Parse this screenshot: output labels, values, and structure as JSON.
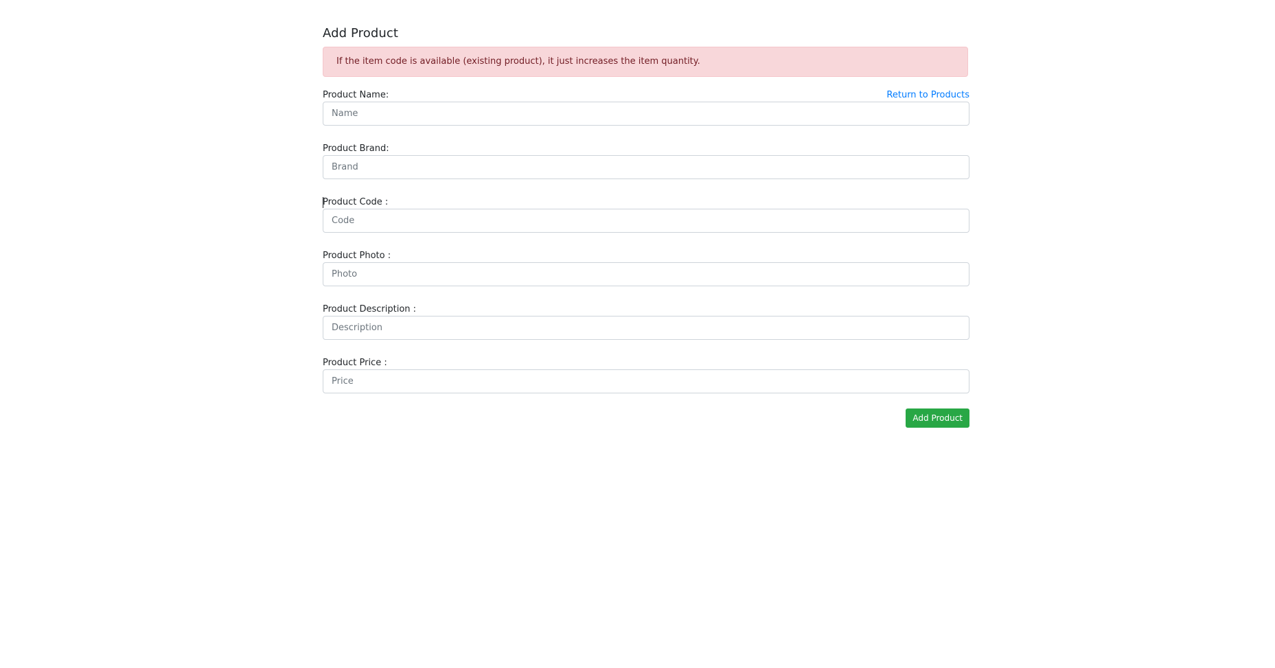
{
  "page": {
    "title": "Add Product"
  },
  "alert": {
    "message": "If the item code is available (existing product), it just increases the item quantity."
  },
  "form": {
    "return_link": "Return to Products",
    "fields": [
      {
        "label": "Product Name:",
        "placeholder": "Name"
      },
      {
        "label": "Product Brand:",
        "placeholder": "Brand"
      },
      {
        "label": "Product Code :",
        "placeholder": "Code"
      },
      {
        "label": "Product Photo :",
        "placeholder": "Photo"
      },
      {
        "label": "Product Description :",
        "placeholder": "Description"
      },
      {
        "label": "Product Price :",
        "placeholder": "Price"
      }
    ],
    "submit_label": "Add Product"
  },
  "colors": {
    "alert_bg": "#f8d7da",
    "alert_text": "#721c24",
    "link": "#007bff",
    "submit_bg": "#28a745"
  }
}
